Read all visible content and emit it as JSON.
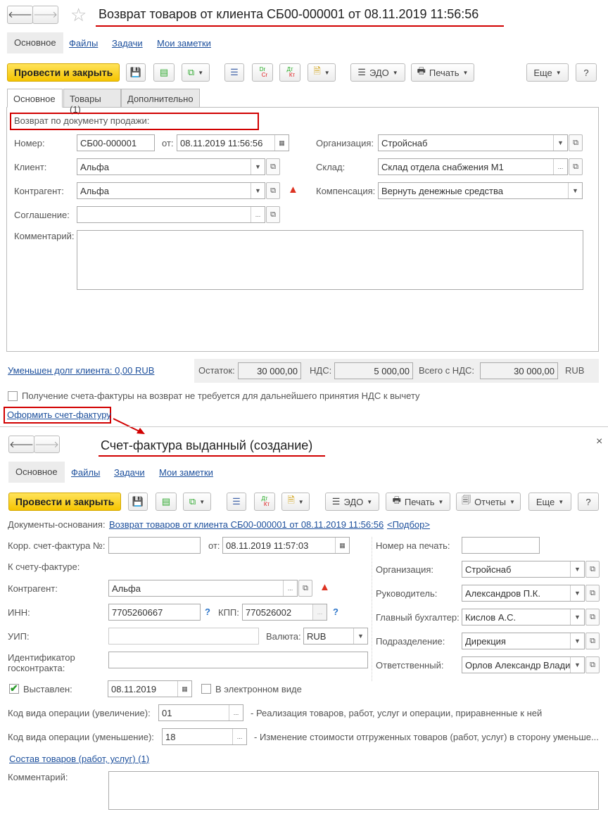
{
  "colors": {
    "accent_yellow": "#f5c400",
    "link": "#1c4f9c",
    "annotation_red": "#d10000",
    "warning": "#dd3322"
  },
  "win1": {
    "title": "Возврат товаров от клиента СБ00-000001 от 08.11.2019 11:56:56",
    "nav": [
      "Основное",
      "Файлы",
      "Задачи",
      "Мои заметки"
    ],
    "toolbar": {
      "post_close": "Провести и закрыть",
      "edo": "ЭДО",
      "print": "Печать",
      "more": "Еще",
      "help": "?",
      "dr": "Dr",
      "cr": "Cr",
      "dt": "Дт",
      "kt": "Кт"
    },
    "tabs": [
      "Основное",
      "Товары (1)",
      "Дополнительно"
    ],
    "group_label": "Возврат по документу продажи:",
    "fields": {
      "number_label": "Номер:",
      "number": "СБ00-000001",
      "from_label": "от:",
      "date": "08.11.2019 11:56:56",
      "client_label": "Клиент:",
      "client": "Альфа",
      "counterparty_label": "Контрагент:",
      "counterparty": "Альфа",
      "agreement_label": "Соглашение:",
      "agreement": "",
      "comment_label": "Комментарий:",
      "org_label": "Организация:",
      "org": "Стройснаб",
      "warehouse_label": "Склад:",
      "warehouse": "Склад отдела снабжения М1",
      "compensation_label": "Компенсация:",
      "compensation": "Вернуть денежные средства"
    },
    "footer": {
      "debt_link": "Уменьшен долг клиента: 0,00 RUB",
      "balance_label": "Остаток:",
      "balance": "30 000,00",
      "vat_label": "НДС:",
      "vat": "5 000,00",
      "total_label": "Всего с НДС:",
      "total": "30 000,00",
      "currency": "RUB"
    },
    "checkbox_text": "Получение счета-фактуры на возврат не требуется для дальнейшего принятия НДС к вычету",
    "create_invoice_link": "Оформить счет-фактуру"
  },
  "win2": {
    "title": "Счет-фактура выданный (создание)",
    "close": "×",
    "nav": [
      "Основное",
      "Файлы",
      "Задачи",
      "Мои заметки"
    ],
    "toolbar": {
      "post_close": "Провести и закрыть",
      "edo": "ЭДО",
      "print": "Печать",
      "reports": "Отчеты",
      "more": "Еще",
      "help": "?",
      "dt": "Дт",
      "kt": "Кт"
    },
    "base_docs_label": "Документы-основания:",
    "base_doc_link": "Возврат товаров от клиента СБ00-000001 от 08.11.2019 11:56:56",
    "pick_link": "<Подбор>",
    "fields": {
      "corr_label": "Корр. счет-фактура №:",
      "corr": "",
      "from_label": "от:",
      "date": "08.11.2019 11:57:03",
      "to_invoice_label": "К счету-фактуре:",
      "counterparty_label": "Контрагент:",
      "counterparty": "Альфа",
      "inn_label": "ИНН:",
      "inn": "7705260667",
      "kpp_label": "КПП:",
      "kpp": "770526002",
      "uip_label": "УИП:",
      "uip": "",
      "currency_label": "Валюта:",
      "currency": "RUB",
      "contract_id_label1": "Идентификатор",
      "contract_id_label2": "госконтракта:",
      "contract_id": "",
      "issued_label": "Выставлен:",
      "issued_checked": true,
      "issued_date": "08.11.2019",
      "electronic_label": "В электронном виде",
      "electronic_checked": false,
      "print_no_label": "Номер на печать:",
      "print_no": "",
      "org_label": "Организация:",
      "org": "Стройснаб",
      "head_label": "Руководитель:",
      "head": "Александров П.К.",
      "accountant_label": "Главный бухгалтер:",
      "accountant": "Кислов А.С.",
      "dept_label": "Подразделение:",
      "dept": "Дирекция",
      "resp_label": "Ответственный:",
      "resp": "Орлов Александр Влади",
      "op_inc_label": "Код вида операции (увеличение):",
      "op_inc": "01",
      "op_inc_desc": "- Реализация товаров, работ, услуг и операции, приравненные к ней",
      "op_dec_label": "Код вида операции (уменьшение):",
      "op_dec": "18",
      "op_dec_desc": "- Изменение стоимости отгруженных товаров (работ, услуг) в сторону уменьше...",
      "goods_link": "Состав товаров (работ, услуг) (1)",
      "comment_label": "Комментарий:"
    }
  }
}
